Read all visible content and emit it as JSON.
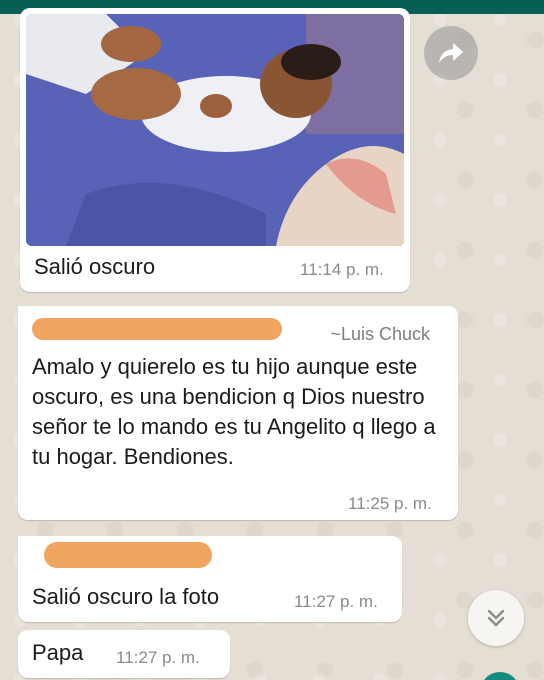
{
  "messages": [
    {
      "type": "image",
      "caption": "Salió oscuro",
      "time": "11:14 p. m."
    },
    {
      "type": "text",
      "sender": "~Luis Chuck",
      "text": "Amalo y quierelo es tu hijo aunque este oscuro, es una bendicion q Dios nuestro señor te lo mando es tu Angelito q llego a tu hogar. Bendiones.",
      "time": "11:25 p. m."
    },
    {
      "type": "text",
      "text": "Salió oscuro la foto",
      "time": "11:27 p. m."
    },
    {
      "type": "text",
      "text": "Papa",
      "time": "11:27 p. m."
    }
  ],
  "icons": {
    "forward": "share-arrow-icon",
    "scroll_down": "double-chevron-down-icon"
  },
  "colors": {
    "header": "#075e54",
    "bubble": "#ffffff",
    "redaction": "#f0a560",
    "timestamp": "#8a8a8a"
  }
}
